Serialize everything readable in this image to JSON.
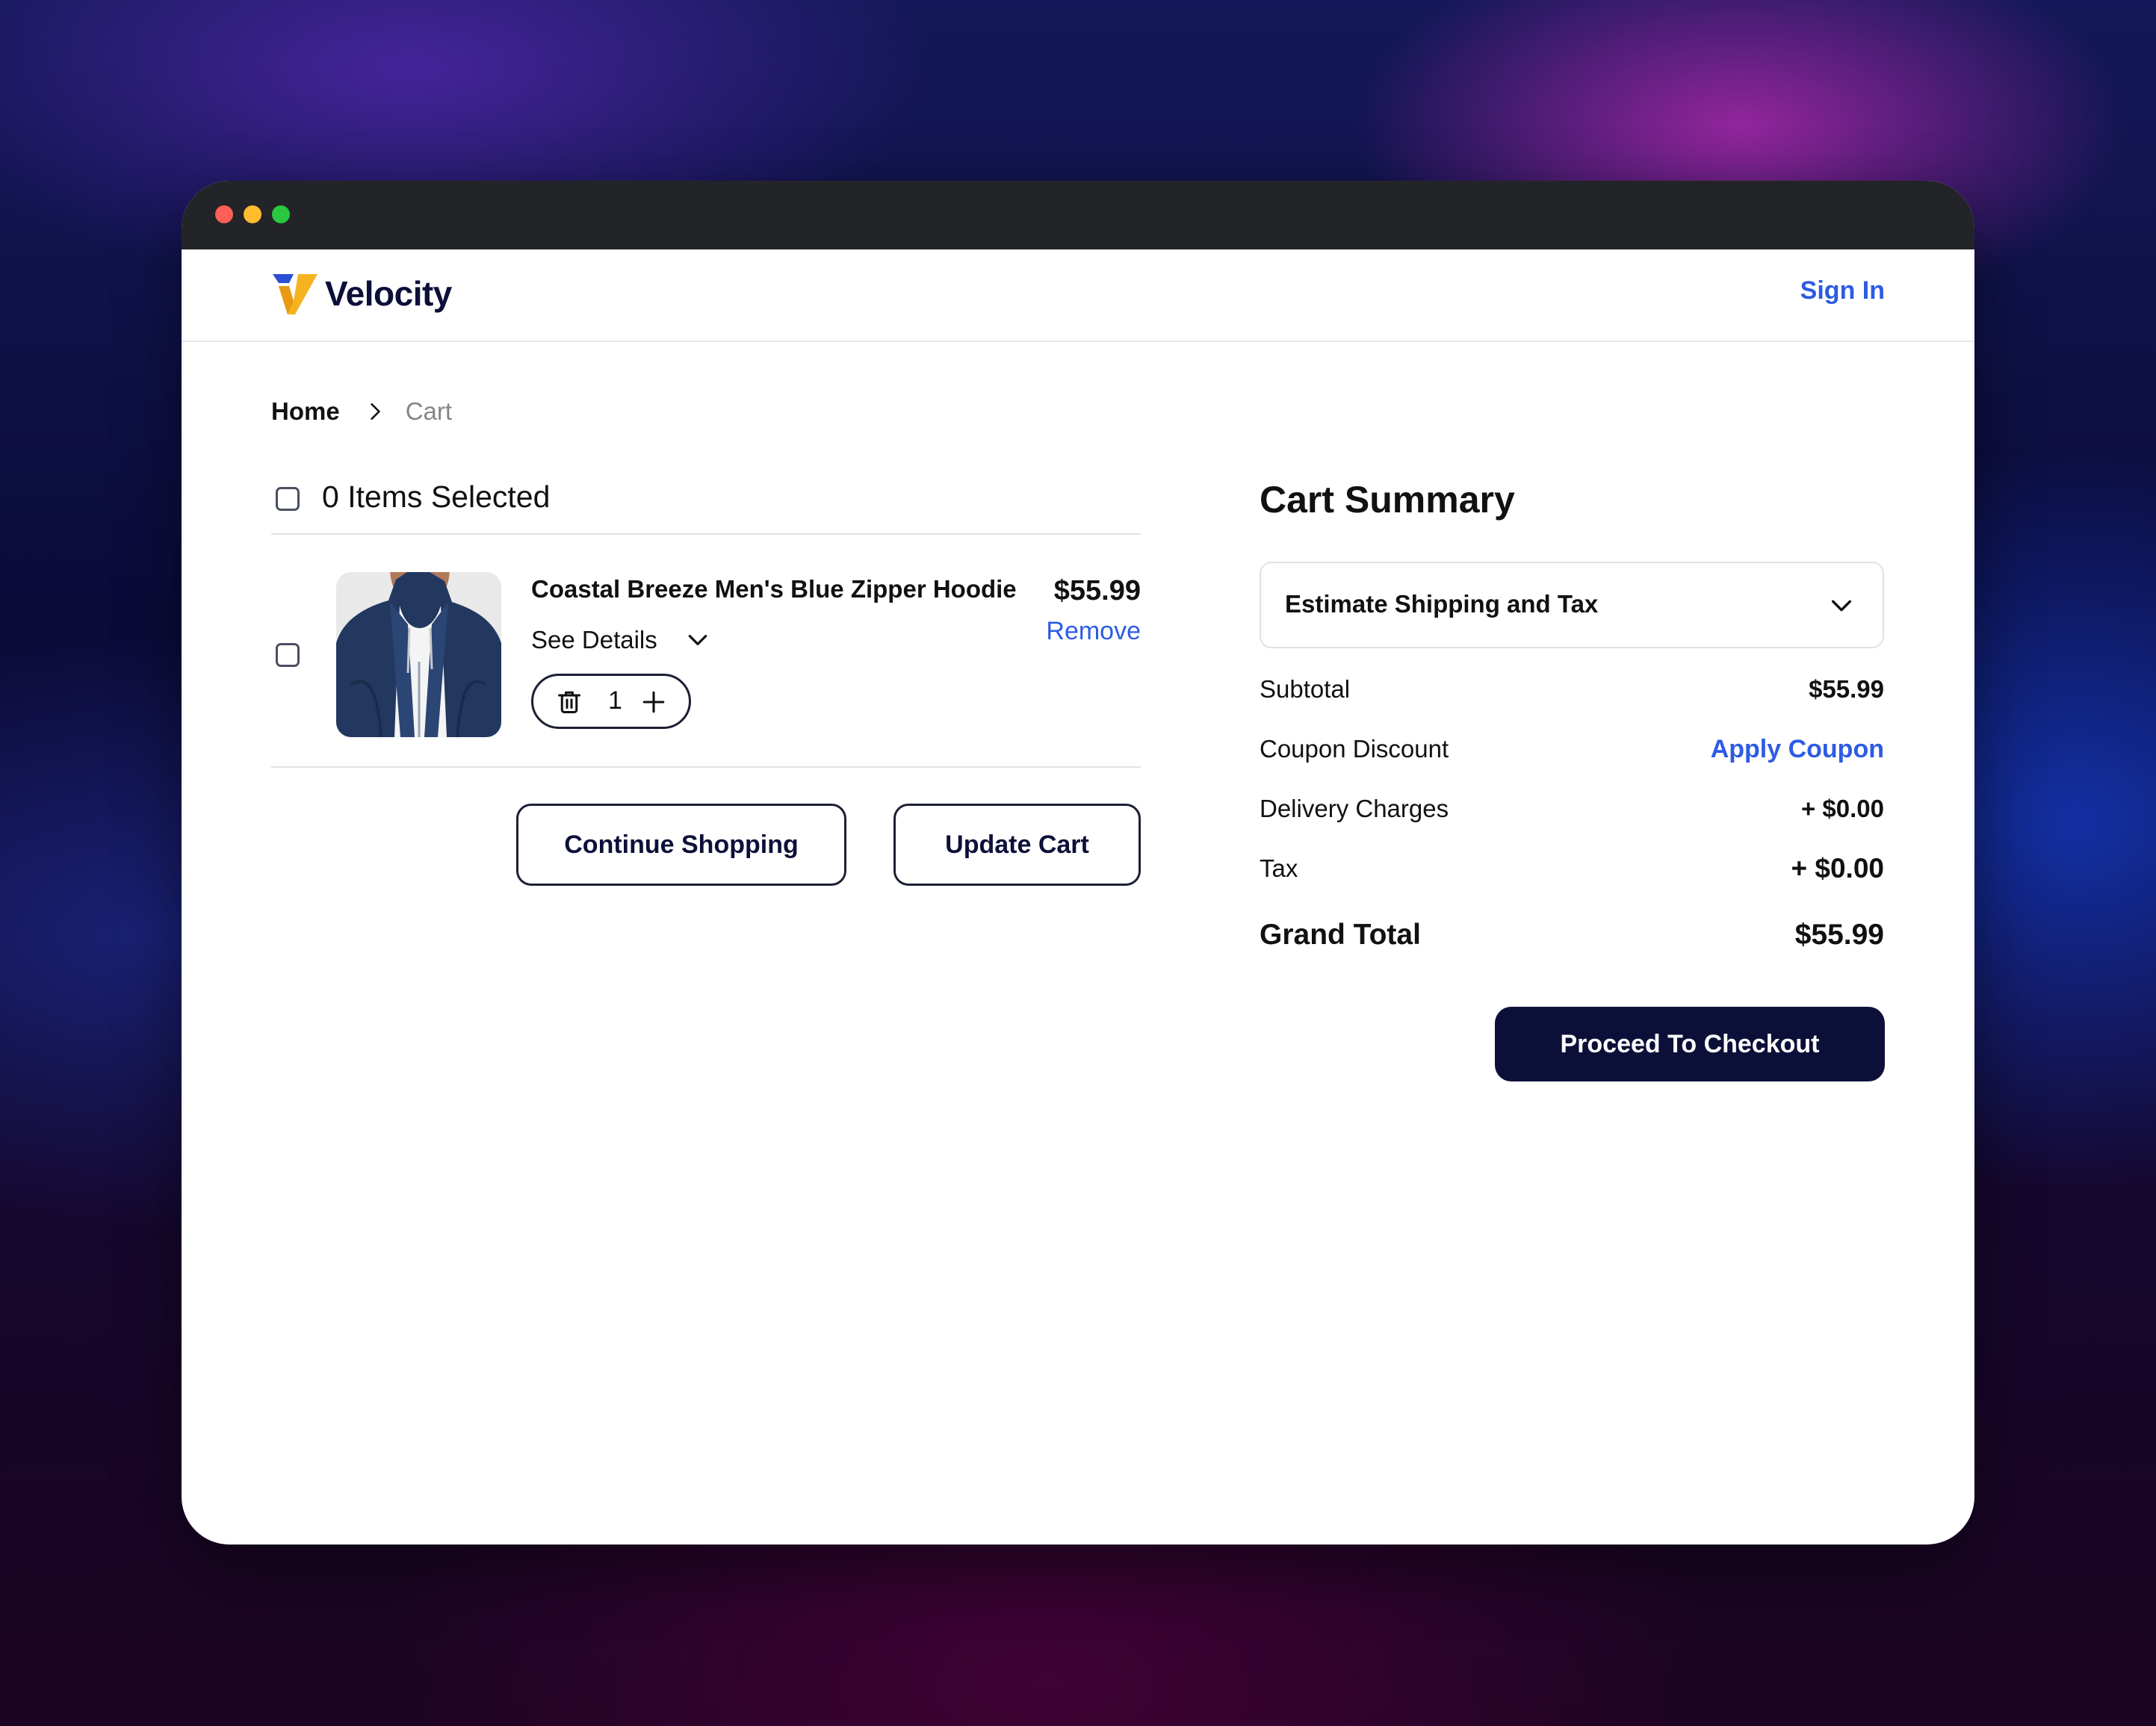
{
  "header": {
    "brand": "Velocity",
    "sign_in": "Sign In"
  },
  "breadcrumb": {
    "home": "Home",
    "current": "Cart"
  },
  "cart": {
    "selection_label": "0 Items Selected",
    "items": [
      {
        "name": "Coastal Breeze Men's Blue Zipper Hoodie",
        "price": "$55.99",
        "remove_label": "Remove",
        "details_label": "See Details",
        "quantity": "1"
      }
    ],
    "continue_label": "Continue Shopping",
    "update_label": "Update Cart"
  },
  "summary": {
    "title": "Cart Summary",
    "estimate_label": "Estimate Shipping and Tax",
    "subtotal_label": "Subtotal",
    "subtotal_value": "$55.99",
    "coupon_label": "Coupon Discount",
    "coupon_action": "Apply Coupon",
    "delivery_label": "Delivery Charges",
    "delivery_value": "+ $0.00",
    "tax_label": "Tax",
    "tax_value": "+ $0.00",
    "grand_total_label": "Grand Total",
    "grand_total_value": "$55.99",
    "checkout_label": "Proceed To Checkout"
  },
  "colors": {
    "accent_link": "#2d5be3",
    "primary_dark": "#0c1039",
    "logo_gold": "#f5b41f",
    "logo_blue": "#2b4fd4"
  },
  "icons": [
    "velocity-logo-icon",
    "chevron-right-icon",
    "chevron-down-icon",
    "trash-icon",
    "plus-icon"
  ]
}
